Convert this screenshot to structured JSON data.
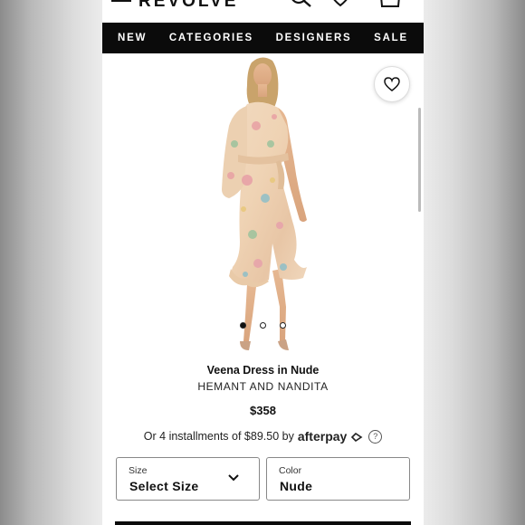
{
  "header": {
    "logo": "REVOLVE"
  },
  "nav": {
    "items": [
      "NEW",
      "CATEGORIES",
      "DESIGNERS",
      "SALE"
    ]
  },
  "product": {
    "title": "Veena Dress in Nude",
    "brand": "HEMANT AND NANDITA",
    "price": "$358",
    "installments_prefix": "Or 4 installments of $89.50 by",
    "afterpay_label": "afterpay",
    "help_symbol": "?",
    "image_count": 3,
    "active_image": 1
  },
  "selectors": {
    "size": {
      "label": "Size",
      "value": "Select Size"
    },
    "color": {
      "label": "Color",
      "value": "Nude"
    }
  },
  "colors": {
    "nav_bg": "#0b0b0b",
    "accent": "#111111"
  }
}
